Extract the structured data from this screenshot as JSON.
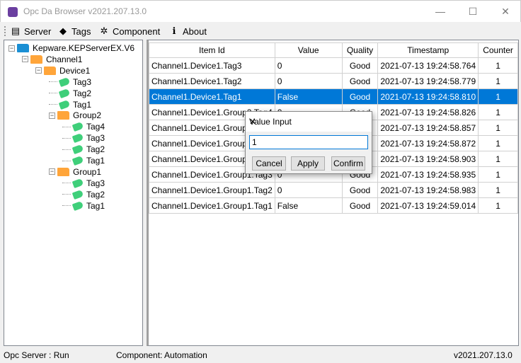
{
  "window": {
    "title": "Opc Da Browser v2021.207.13.0",
    "minimize": "—",
    "maximize": "☐",
    "close": "✕"
  },
  "toolbar": {
    "items": [
      {
        "label": "Server",
        "icon": "server-icon",
        "glyph": "▤"
      },
      {
        "label": "Tags",
        "icon": "tag-icon",
        "glyph": "◆"
      },
      {
        "label": "Component",
        "icon": "gear-icon",
        "glyph": "✲"
      },
      {
        "label": "About",
        "icon": "info-icon",
        "glyph": "ℹ"
      }
    ]
  },
  "tree": [
    {
      "label": "Kepware.KEPServerEX.V6",
      "level": 0,
      "type": "root"
    },
    {
      "label": "Channel1",
      "level": 1,
      "type": "folder"
    },
    {
      "label": "Device1",
      "level": 2,
      "type": "folder"
    },
    {
      "label": "Tag3",
      "level": 3,
      "type": "tag"
    },
    {
      "label": "Tag2",
      "level": 3,
      "type": "tag"
    },
    {
      "label": "Tag1",
      "level": 3,
      "type": "tag"
    },
    {
      "label": "Group2",
      "level": 3,
      "type": "folder"
    },
    {
      "label": "Tag4",
      "level": 4,
      "type": "tag"
    },
    {
      "label": "Tag3",
      "level": 4,
      "type": "tag"
    },
    {
      "label": "Tag2",
      "level": 4,
      "type": "tag"
    },
    {
      "label": "Tag1",
      "level": 4,
      "type": "tag"
    },
    {
      "label": "Group1",
      "level": 3,
      "type": "folder"
    },
    {
      "label": "Tag3",
      "level": 4,
      "type": "tag"
    },
    {
      "label": "Tag2",
      "level": 4,
      "type": "tag"
    },
    {
      "label": "Tag1",
      "level": 4,
      "type": "tag"
    }
  ],
  "table": {
    "columns": [
      "Item Id",
      "Value",
      "Quality",
      "Timestamp",
      "Counter"
    ],
    "selected_row": 2,
    "rows": [
      [
        "Channel1.Device1.Tag3",
        "0",
        "Good",
        "2021-07-13 19:24:58.764",
        "1"
      ],
      [
        "Channel1.Device1.Tag2",
        "0",
        "Good",
        "2021-07-13 19:24:58.779",
        "1"
      ],
      [
        "Channel1.Device1.Tag1",
        "False",
        "Good",
        "2021-07-13 19:24:58.810",
        "1"
      ],
      [
        "Channel1.Device1.Group2.Tag4",
        "0",
        "Good",
        "2021-07-13 19:24:58.826",
        "1"
      ],
      [
        "Channel1.Device1.Group2.Tag3",
        "",
        "",
        "2021-07-13 19:24:58.857",
        "1"
      ],
      [
        "Channel1.Device1.Group2.Tag2",
        "",
        "",
        "2021-07-13 19:24:58.872",
        "1"
      ],
      [
        "Channel1.Device1.Group2.Tag1",
        "",
        "",
        "2021-07-13 19:24:58.903",
        "1"
      ],
      [
        "Channel1.Device1.Group1.Tag3",
        "0",
        "Good",
        "2021-07-13 19:24:58.935",
        "1"
      ],
      [
        "Channel1.Device1.Group1.Tag2",
        "0",
        "Good",
        "2021-07-13 19:24:58.983",
        "1"
      ],
      [
        "Channel1.Device1.Group1.Tag1",
        "False",
        "Good",
        "2021-07-13 19:24:59.014",
        "1"
      ]
    ]
  },
  "dialog": {
    "title": "Value Input",
    "value": "1",
    "cancel": "Cancel",
    "apply": "Apply",
    "confirm": "Confirm"
  },
  "status": {
    "server": "Opc Server : Run",
    "component": "Component: Automation",
    "version": "v2021.207.13.0"
  },
  "colors": {
    "selection": "#0078d7",
    "tag": "#3fcf7a",
    "folder": "#ffa53a",
    "root_folder": "#1a8fd4"
  }
}
